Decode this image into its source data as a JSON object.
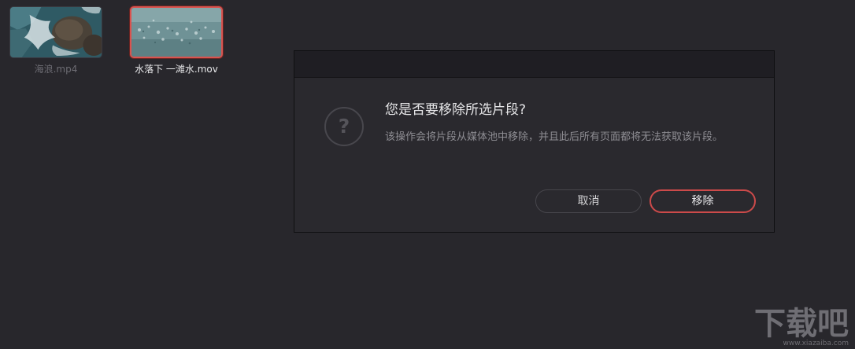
{
  "media_pool": {
    "clips": [
      {
        "name": "海浪.mp4",
        "selected": false
      },
      {
        "name": "水落下 一滩水.mov",
        "selected": true
      }
    ]
  },
  "dialog": {
    "icon": "question-mark-icon",
    "heading": "您是否要移除所选片段?",
    "message": "该操作会将片段从媒体池中移除，并且此后所有页面都将无法获取该片段。",
    "cancel_label": "取消",
    "remove_label": "移除"
  },
  "watermark": {
    "logo_text": "下载吧",
    "url": "www.xiazaiba.com"
  },
  "colors": {
    "background": "#28272c",
    "dialog_background": "#2a292e",
    "accent_red": "#cc4a4a"
  }
}
